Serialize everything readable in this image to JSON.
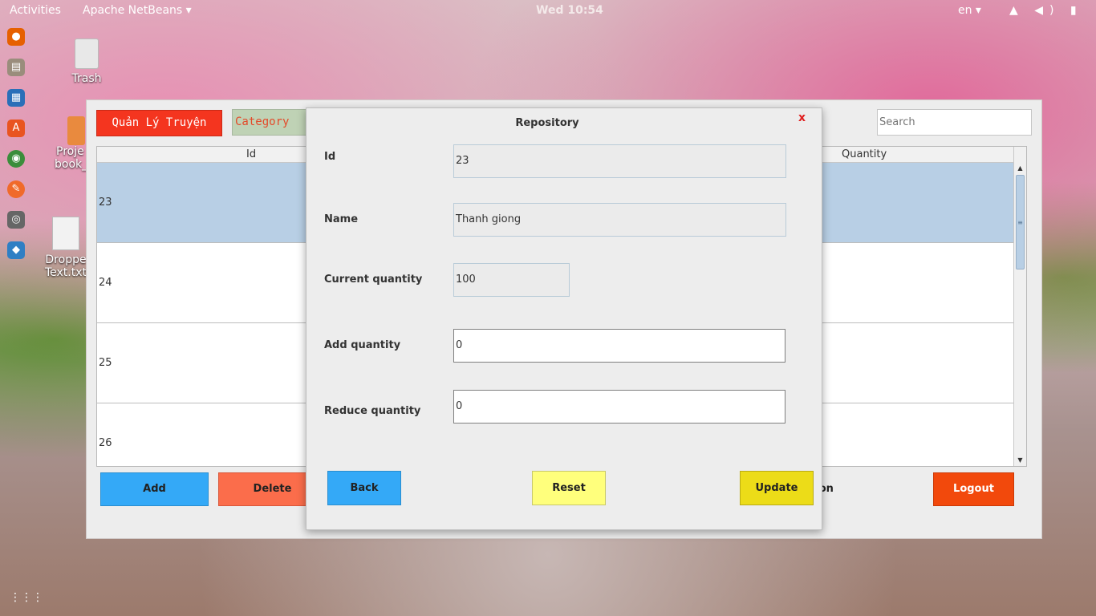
{
  "topbar": {
    "activities": "Activities",
    "app_menu": "Apache NetBeans ▾",
    "clock": "Wed 10:54",
    "lang": "en ▾",
    "tray": "▲ ◀) ▮"
  },
  "desktop": {
    "trash_label": "Trash",
    "project_label_1": "Proje",
    "project_label_2": "book_",
    "dropped_label_1": "Droppe",
    "dropped_label_2": "Text.txt"
  },
  "app": {
    "title_button": "Quản Lý Truyện",
    "category_button": "Category",
    "search_placeholder": "Search",
    "table": {
      "columns": [
        "Id",
        "Quantity"
      ],
      "rows": [
        {
          "id": "23",
          "selected": true
        },
        {
          "id": "24",
          "selected": false
        },
        {
          "id": "25",
          "selected": false
        },
        {
          "id": "26",
          "selected": false
        }
      ]
    },
    "buttons": {
      "add": "Add",
      "delete": "Delete",
      "partial_label": "son",
      "logout": "Logout"
    }
  },
  "dialog": {
    "title": "Repository",
    "close": "x",
    "fields": {
      "id_label": "Id",
      "id_value": "23",
      "name_label": "Name",
      "name_value": "Thanh giong",
      "current_label": "Current quantity",
      "current_value": "100",
      "add_label": "Add quantity",
      "add_value": "0",
      "reduce_label": "Reduce quantity",
      "reduce_value": "0"
    },
    "buttons": {
      "back": "Back",
      "reset": "Reset",
      "update": "Update"
    }
  },
  "colors": {
    "title_button": "#f4351f",
    "category": "#bfd2b5",
    "add_button": "#34a9f7",
    "delete_button": "#fb6d4b",
    "logout_button": "#f2490c",
    "reset_button": "#ffff7c",
    "update_button": "#ecdc18",
    "selected_row": "#b8cfe5"
  }
}
